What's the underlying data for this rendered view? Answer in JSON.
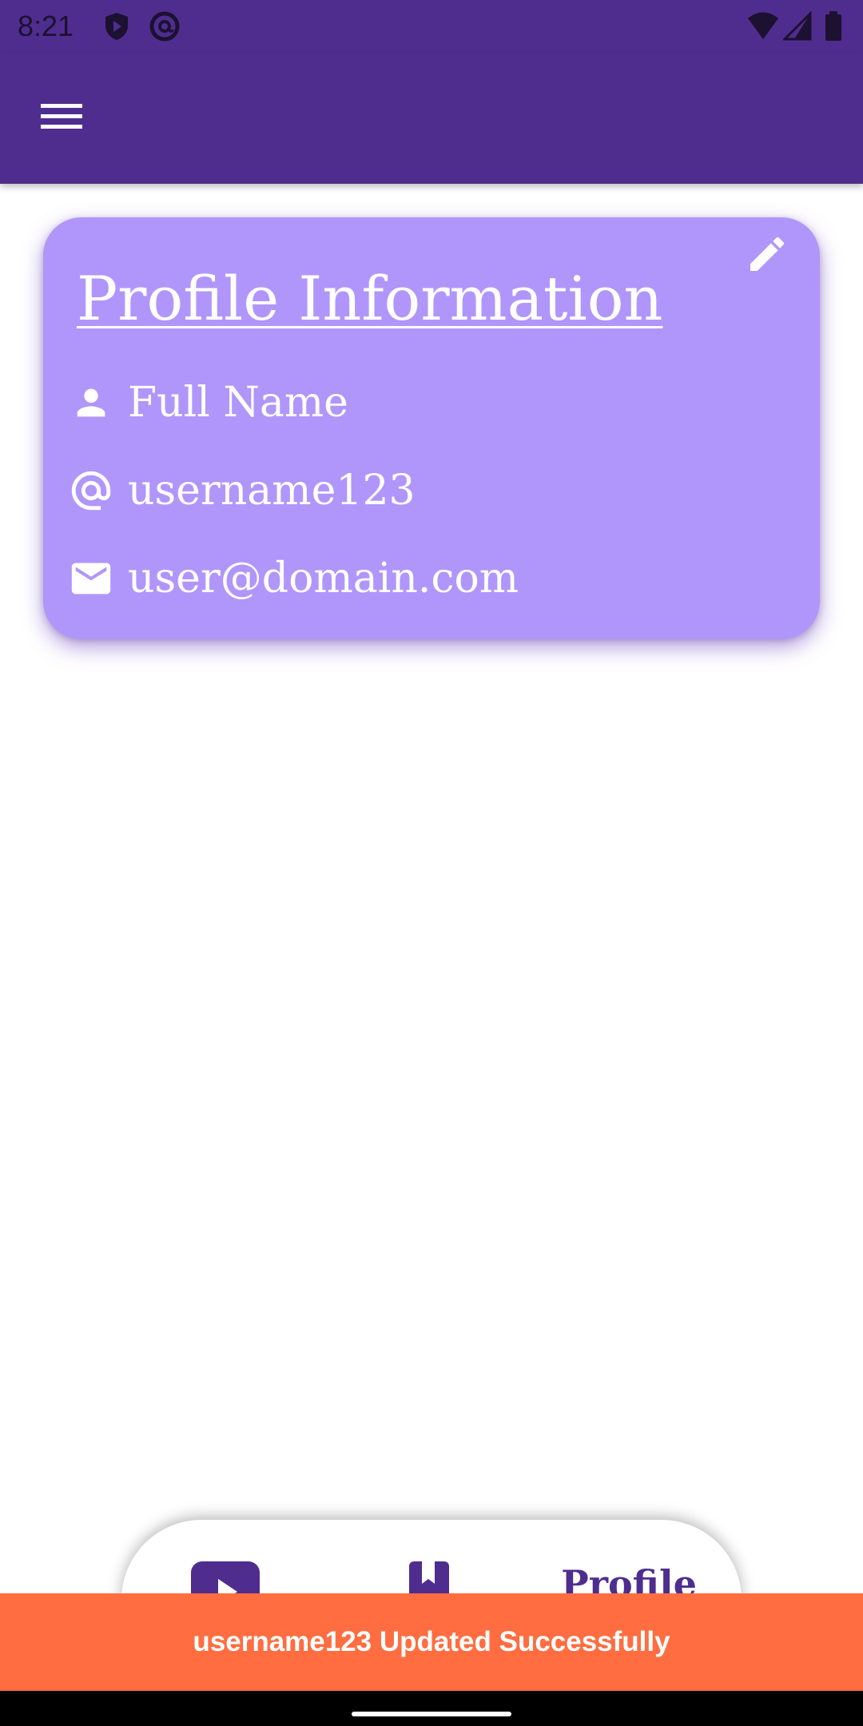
{
  "status_bar": {
    "time": "8:21",
    "left_icons": [
      "shield-play-icon",
      "at-circle-icon"
    ],
    "right_icons": [
      "wifi-icon",
      "cell-signal-icon",
      "battery-icon"
    ]
  },
  "app_bar": {
    "menu_icon": "hamburger-menu-icon",
    "color": "#4f2d8f"
  },
  "profile_card": {
    "title": "Profile Information",
    "edit_icon": "pencil-icon",
    "background": "#b096fb",
    "rows": [
      {
        "icon": "person-icon",
        "text": "Full Name"
      },
      {
        "icon": "at-icon",
        "text": "username123"
      },
      {
        "icon": "mail-icon",
        "text": "user@domain.com"
      }
    ]
  },
  "bottom_nav": {
    "items": [
      {
        "icon": "play-video-icon"
      },
      {
        "icon": "bookmark-search-icon"
      },
      {
        "label": "Profile"
      }
    ]
  },
  "snackbar": {
    "message": "username123 Updated Successfully",
    "color": "#ff6d40"
  }
}
